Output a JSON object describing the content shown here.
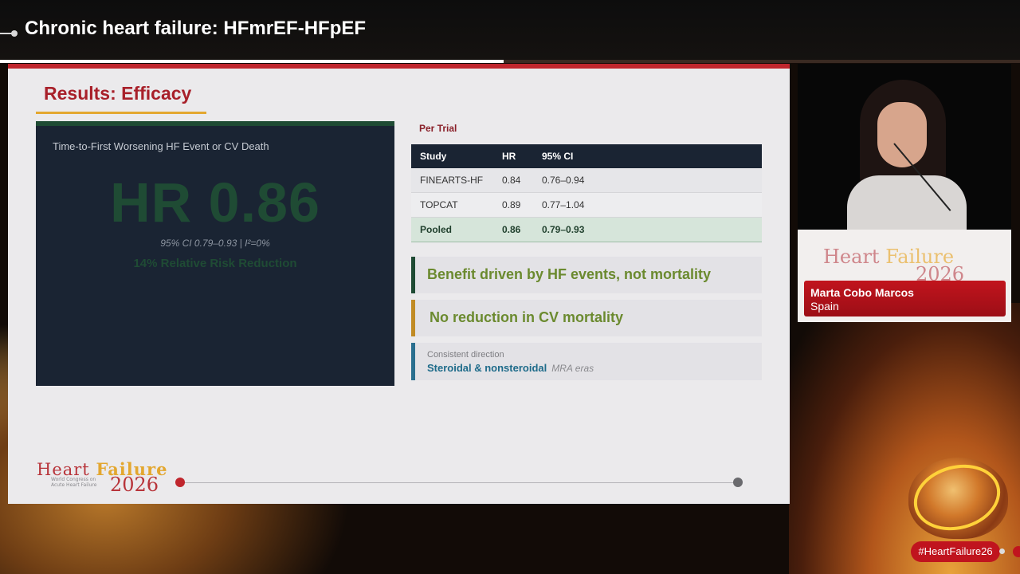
{
  "header": {
    "title": "Chronic heart failure: HFmrEF-HFpEF",
    "video_progress": 0.494
  },
  "slide": {
    "title": "Results: Efficacy",
    "hr_panel": {
      "subtitle": "Time-to-First Worsening HF Event or CV Death",
      "hr_value": "HR 0.86",
      "ci": "95% CI 0.79–0.93  |  I²=0%",
      "rrr": "14% Relative Risk Reduction"
    },
    "per_trial_label": "Per Trial",
    "table": {
      "headers": [
        "Study",
        "HR",
        "95% CI"
      ],
      "rows": [
        [
          "FINEARTS-HF",
          "0.84",
          "0.76–0.94"
        ],
        [
          "TOPCAT",
          "0.89",
          "0.77–1.04"
        ],
        [
          "Pooled",
          "0.86",
          "0.79–0.93"
        ]
      ]
    },
    "callouts": {
      "benefit": "Benefit driven by HF events, not mortality",
      "no_reduction": "No reduction in CV mortality",
      "consistent_label": "Consistent direction",
      "consistent_text": "Steroidal & nonsteroidal",
      "consistent_suffix": "MRA eras"
    },
    "footer_logo": {
      "heart": "Heart",
      "failure": "Failure",
      "subtitle_line1": "World Congress on",
      "subtitle_line2": "Acute Heart Failure",
      "year": "2026"
    }
  },
  "speaker": {
    "name": "Marta Cobo Marcos",
    "country": "Spain",
    "podium_heart": "Heart",
    "podium_failure": "Failure",
    "podium_year": "2026"
  },
  "hashtag": "#HeartFailure26",
  "colors": {
    "accent_red": "#c0262d",
    "accent_gold": "#e3a72f",
    "dark_navy": "#1a2433",
    "dark_green": "#1f4b34"
  }
}
